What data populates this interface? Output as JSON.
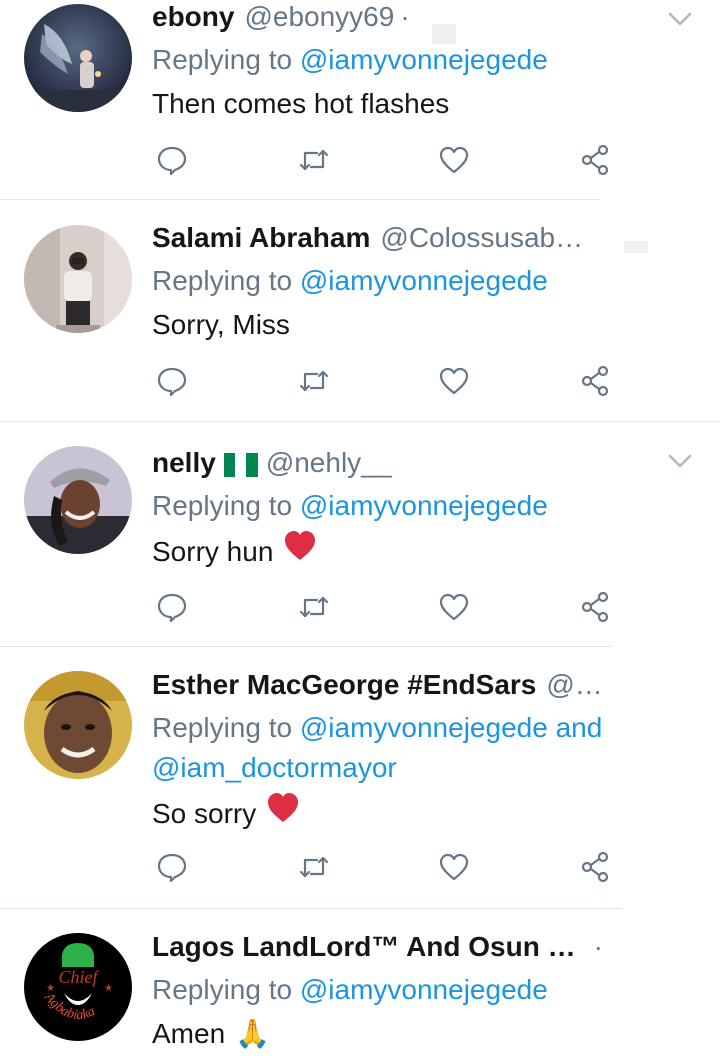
{
  "colors": {
    "name": "#14171a",
    "secondary": "#657786",
    "link": "#1b95e0",
    "divider": "#e1e8ed",
    "heart": "#dd2e44"
  },
  "icons": {
    "reply": "speech-bubble-icon",
    "retweet": "retweet-icon",
    "like": "heart-icon",
    "share": "share-icon",
    "more": "chevron-down-icon"
  },
  "replying_prefix": "Replying to",
  "tweets": [
    {
      "name": "ebony",
      "handle": "@ebonyy69",
      "dot": "·",
      "reply_to": "@iamyvonnejegede",
      "text": "Then comes hot flashes"
    },
    {
      "name": "Salami Abraham",
      "handle": "@Colossusab…",
      "reply_to": "@iamyvonnejegede",
      "text": "Sorry, Miss"
    },
    {
      "name": "nelly",
      "handle": "@nehly__",
      "reply_to": "@iamyvonnejegede",
      "text": "Sorry hun",
      "emoji": "❤️"
    },
    {
      "name": "Esther MacGeorge #EndSars",
      "handle": "@…",
      "reply_to": "@iamyvonnejegede",
      "reply_joiner": "and",
      "reply_to_2": "@iam_doctormayor",
      "text": "So sorry",
      "emoji": "❤️"
    },
    {
      "name": "Lagos LandLord™ And Osun …",
      "dot": "·",
      "reply_to": "@iamyvonnejegede",
      "text": "Amen",
      "emoji": "🙏",
      "avatar_text_1": "Chief",
      "avatar_text_2": "Agbabiaka"
    }
  ]
}
